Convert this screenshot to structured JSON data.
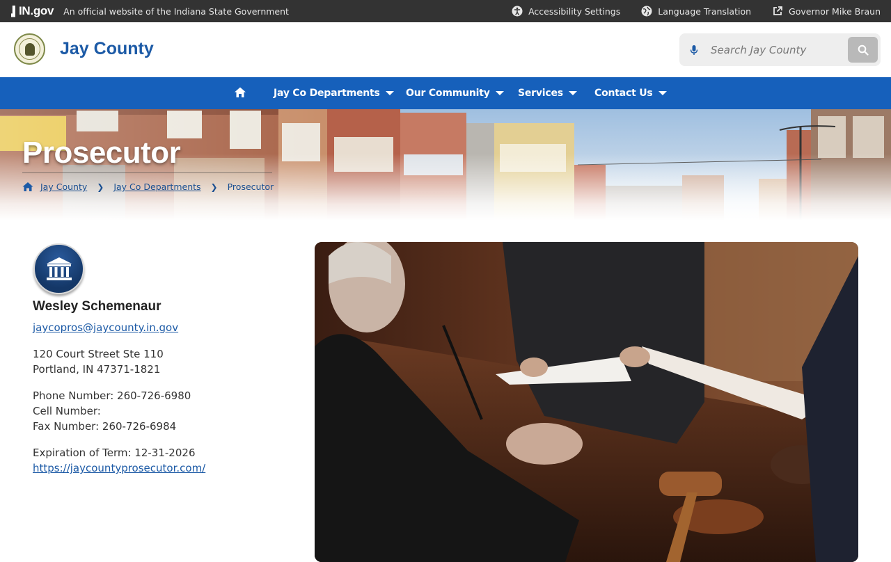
{
  "statebar": {
    "logo_text": "IN.gov",
    "official_text": "An official website of the Indiana State Government",
    "links": [
      {
        "label": "Accessibility Settings",
        "icon": "accessibility-icon"
      },
      {
        "label": "Language Translation",
        "icon": "globe-icon"
      },
      {
        "label": "Governor Mike Braun",
        "icon": "external-link-icon"
      }
    ]
  },
  "header": {
    "site_title": "Jay County",
    "seal_icon": "county-seal-logo",
    "search": {
      "placeholder": "Search Jay County",
      "value": ""
    }
  },
  "nav": {
    "home_icon": "home-icon",
    "items": [
      {
        "label": "Jay Co Departments"
      },
      {
        "label": "Our Community"
      },
      {
        "label": "Services"
      },
      {
        "label": "Contact Us"
      }
    ]
  },
  "hero": {
    "title": "Prosecutor",
    "breadcrumb": [
      {
        "label": "Jay County"
      },
      {
        "label": "Jay Co Departments"
      },
      {
        "label": "Prosecutor"
      }
    ]
  },
  "contact": {
    "icon": "courthouse-icon",
    "name": "Wesley Schemenaur",
    "email": "jaycopros@jaycounty.in.gov",
    "address_line1": "120 Court Street Ste 110",
    "address_line2": "Portland, IN 47371-1821",
    "phone": "Phone Number: 260-726-6980",
    "cell": "Cell Number:",
    "fax": "Fax Number: 260-726-6984",
    "term": "Expiration of Term: 12-31-2026",
    "website": "https://jaycountyprosecutor.com/"
  },
  "colors": {
    "statebar_bg": "#333333",
    "brand_blue": "#1c5aa6",
    "nav_bg": "#1660bb",
    "badge_navy": "#143767"
  }
}
